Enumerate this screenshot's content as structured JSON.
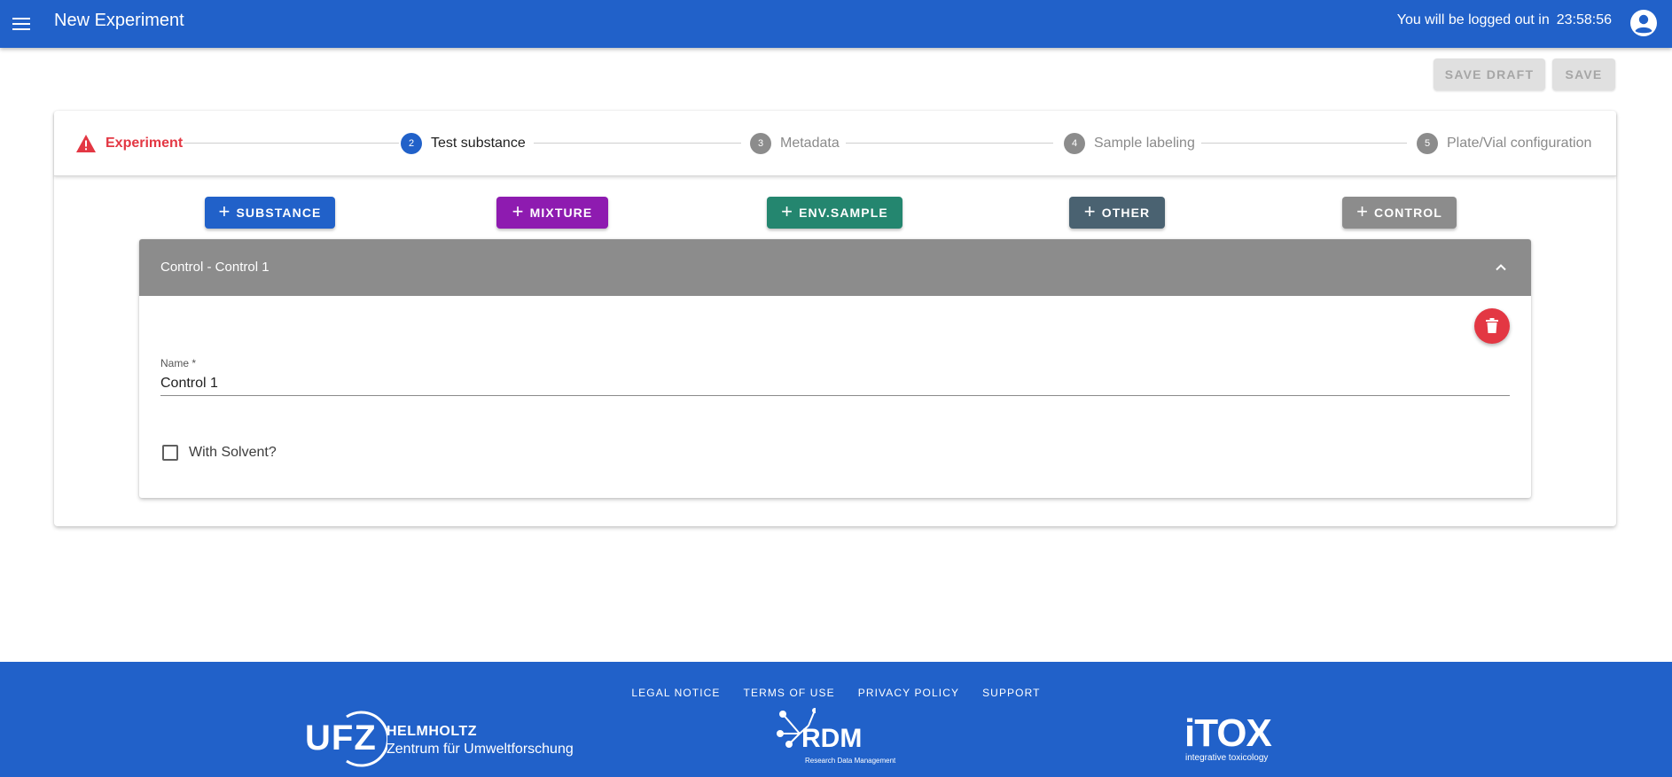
{
  "appbar": {
    "title": "New Experiment",
    "logout_text": "You will be logged out in",
    "logout_timer": "23:58:56"
  },
  "actions": {
    "save_draft": "SAVE DRAFT",
    "save": "SAVE"
  },
  "stepper": {
    "steps": [
      {
        "number": "",
        "label": "Experiment",
        "state": "error"
      },
      {
        "number": "2",
        "label": "Test substance",
        "state": "active"
      },
      {
        "number": "3",
        "label": "Metadata",
        "state": "inactive"
      },
      {
        "number": "4",
        "label": "Sample labeling",
        "state": "inactive"
      },
      {
        "number": "5",
        "label": "Plate/Vial configuration",
        "state": "inactive"
      }
    ]
  },
  "add_buttons": [
    {
      "label": "SUBSTANCE",
      "color": "#2161c9"
    },
    {
      "label": "MIXTURE",
      "color": "#8e1bb0"
    },
    {
      "label": "ENV.SAMPLE",
      "color": "#24866f"
    },
    {
      "label": "OTHER",
      "color": "#4a6271"
    },
    {
      "label": "CONTROL",
      "color": "#8c8c8c"
    }
  ],
  "panel": {
    "title": "Control - Control 1",
    "name_label": "Name *",
    "name_value": "Control 1",
    "checkbox_label": "With Solvent?",
    "checkbox_checked": false
  },
  "footer": {
    "links": [
      "LEGAL NOTICE",
      "TERMS OF USE",
      "PRIVACY POLICY",
      "SUPPORT"
    ],
    "logos": {
      "ufz_mark": "UFZ",
      "ufz_name": "HELMHOLTZ",
      "ufz_sub": "Zentrum für Umweltforschung",
      "rdm_mark": "RDM",
      "rdm_sub": "Research Data Management",
      "itox_mark": "iTOX",
      "itox_sub": "integrative toxicology"
    }
  },
  "colors": {
    "primary": "#2161c9",
    "error": "#e33743",
    "inactive": "#8c8c8c"
  }
}
